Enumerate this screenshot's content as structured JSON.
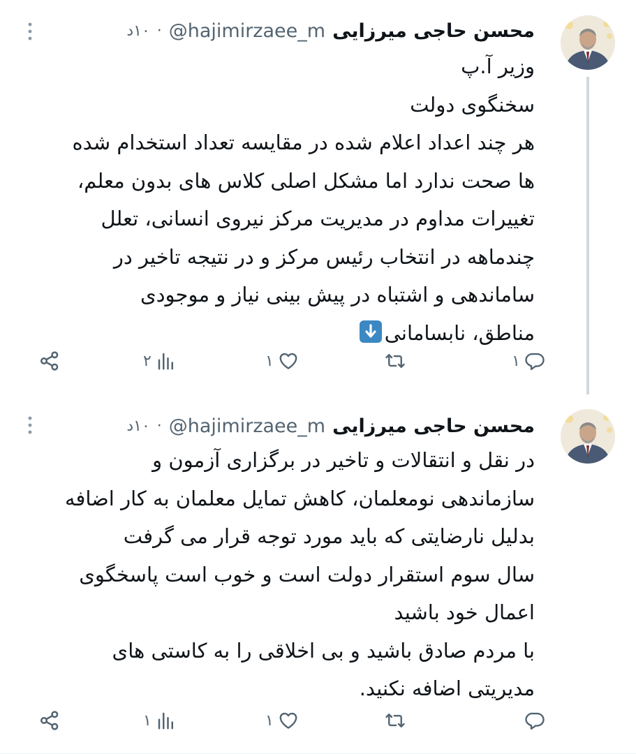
{
  "tweets": [
    {
      "author_name": "محسن حاجی میرزایی",
      "handle": "@hajimirzaee_m",
      "dot": "·",
      "time": "۱۰د",
      "lines": [
        "وزیر آ.پ",
        "سخنگوی دولت",
        "هر چند اعداد اعلام شده در مقایسه تعداد استخدام شده",
        "ها صحت ندارد اما مشکل اصلی کلاس های بدون معلم،",
        "تغییرات مداوم در مدیریت مرکز نیروی انسانی، تعلل",
        "چندماهه در انتخاب رئیس مرکز و در نتیجه تاخیر در",
        "ساماندهی و اشتباه در پیش بینی نیاز و موجودی",
        "مناطق، نابسامانی"
      ],
      "emoji": "down-arrow-emoji",
      "actions": {
        "reply_count": "۱",
        "retweet_count": "",
        "like_count": "۱",
        "views_count": "۲"
      }
    },
    {
      "author_name": "محسن حاجی میرزایی",
      "handle": "@hajimirzaee_m",
      "dot": "·",
      "time": "۱۰د",
      "lines": [
        "در نقل و انتقالات و تاخیر در برگزاری آزمون و",
        "سازماندهی نومعلمان، کاهش تمایل معلمان به کار اضافه",
        "بدلیل نارضایتی که باید مورد توجه قرار می گرفت",
        "سال سوم استقرار دولت است و خوب است پاسخگوی",
        "اعمال خود باشید",
        "با مردم صادق باشید و بی اخلاقی را به کاستی های",
        "مدیریتی اضافه نکنید."
      ],
      "actions": {
        "reply_count": "",
        "retweet_count": "",
        "like_count": "۱",
        "views_count": "۱"
      }
    }
  ],
  "icons": {
    "reply": "reply-icon",
    "retweet": "retweet-icon",
    "like": "heart-icon",
    "views": "views-icon",
    "share": "share-icon",
    "more": "more-vertical-icon"
  },
  "colors": {
    "text": "#0f1419",
    "secondary": "#536471",
    "thread_line": "#cfd9de",
    "emoji_blue": "#3b88c3"
  }
}
